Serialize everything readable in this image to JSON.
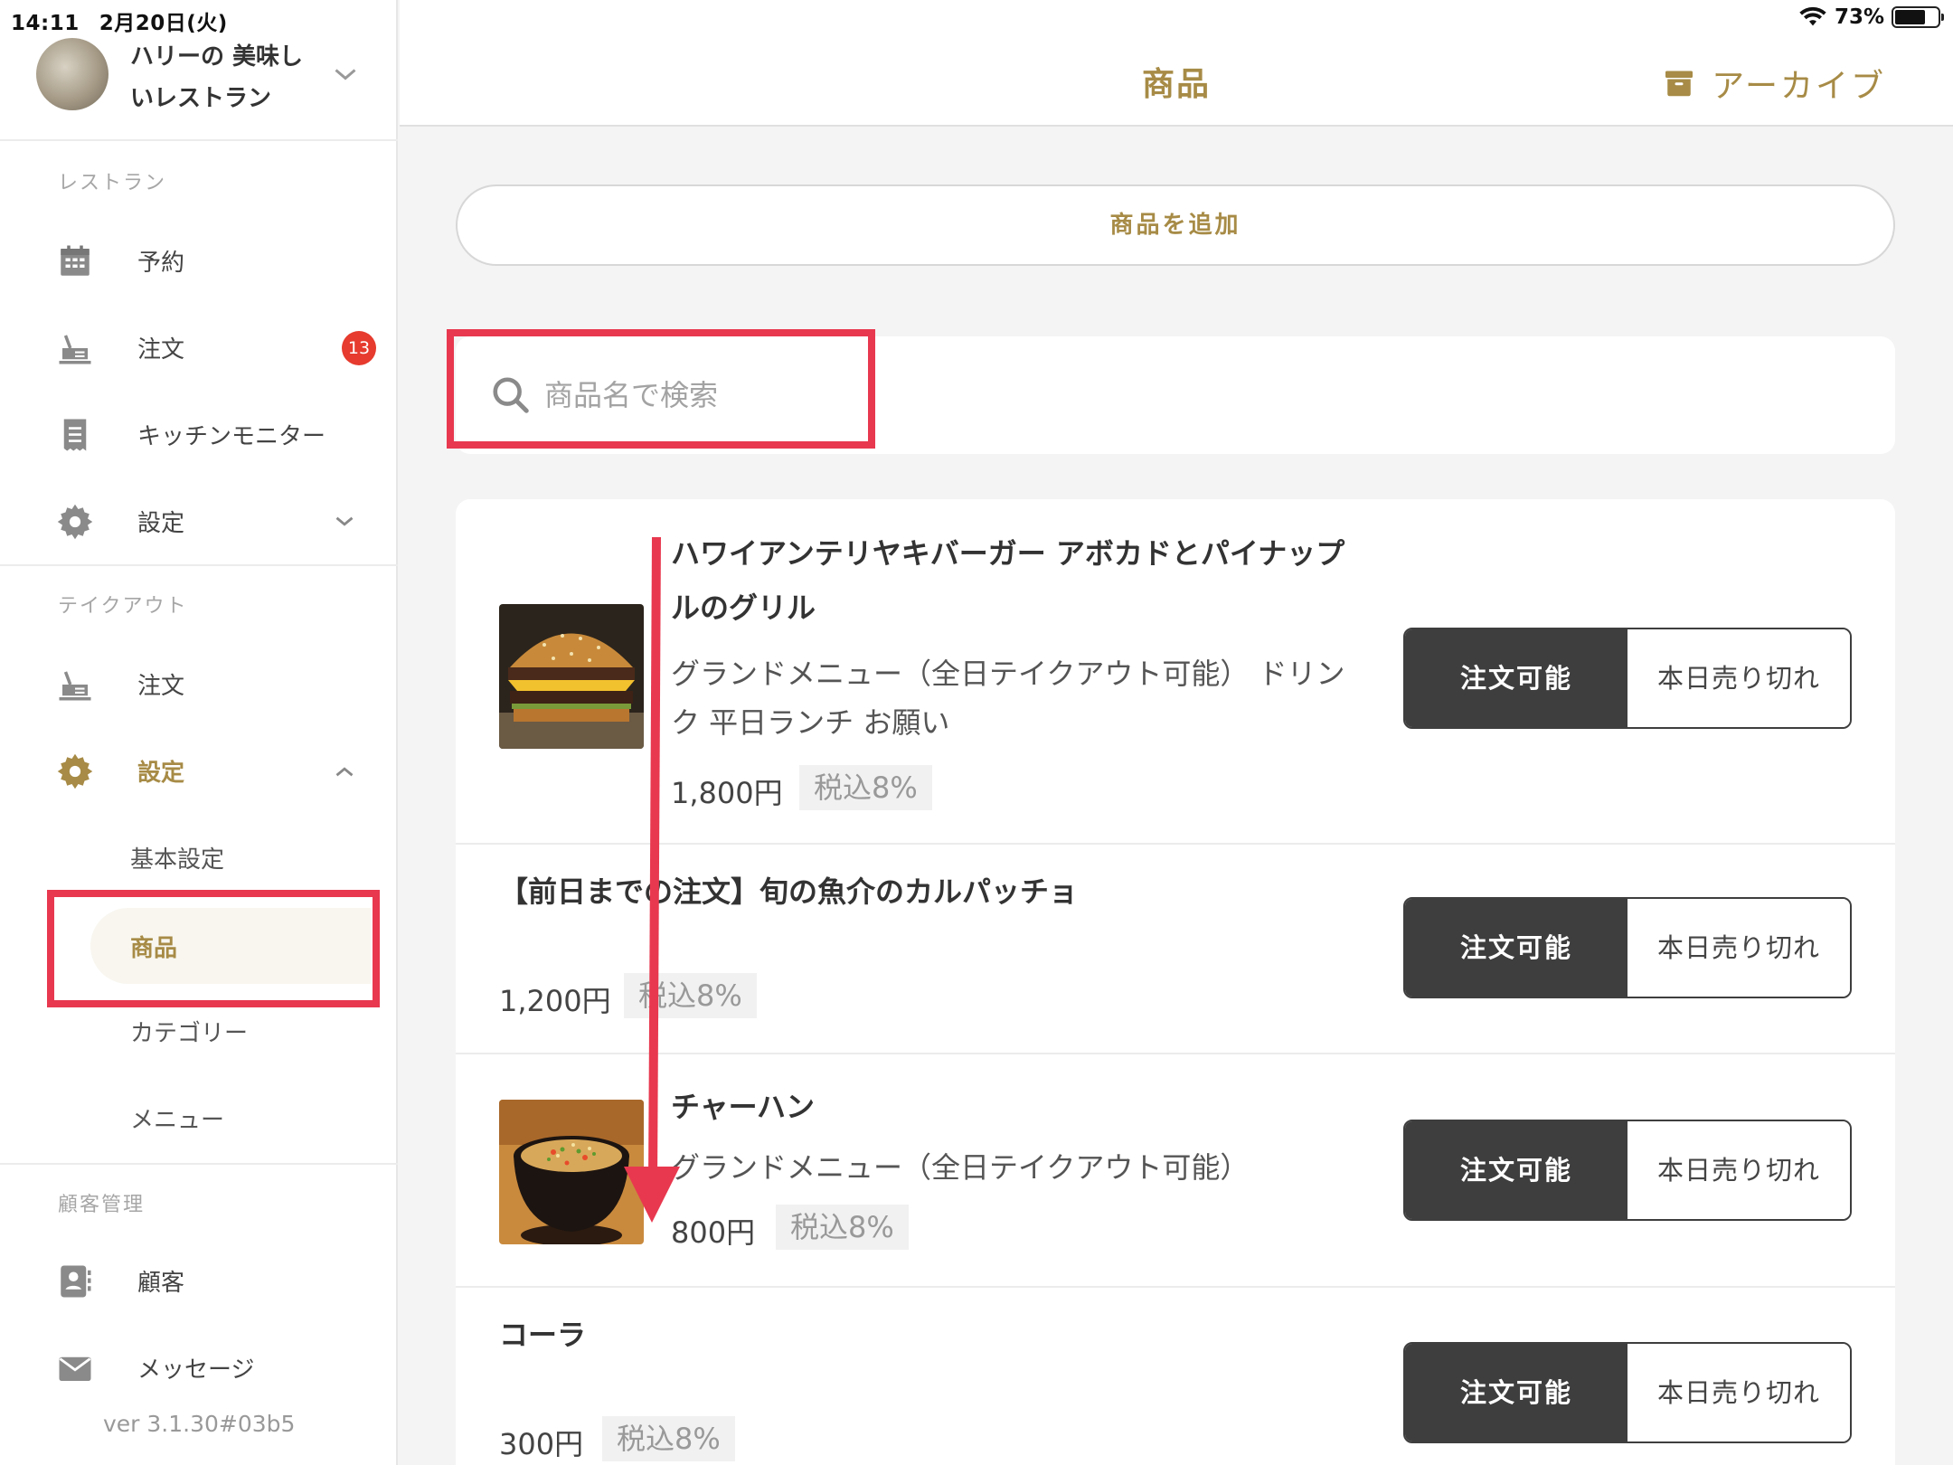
{
  "status_bar": {
    "time": "14:11",
    "date": "2月20日(火)",
    "battery": "73%"
  },
  "account": {
    "name": "ハリーの 美味しいレストラン"
  },
  "sidebar": {
    "restaurant_label": "レストラン",
    "restaurant_items": [
      {
        "label": "予約",
        "icon": "calendar-icon"
      },
      {
        "label": "注文",
        "icon": "order-icon",
        "badge": "13"
      },
      {
        "label": "キッチンモニター",
        "icon": "receipt-icon"
      },
      {
        "label": "設定",
        "icon": "gear-icon"
      }
    ],
    "takeout_label": "テイクアウト",
    "takeout_items": [
      {
        "label": "注文",
        "icon": "order-icon"
      },
      {
        "label": "設定",
        "icon": "gear-icon"
      }
    ],
    "settings_sub": [
      "基本設定",
      "商品",
      "カテゴリー",
      "メニュー"
    ],
    "customer_label": "顧客管理",
    "customer_items": [
      {
        "label": "顧客",
        "icon": "contact-icon"
      },
      {
        "label": "メッセージ",
        "icon": "mail-icon"
      }
    ],
    "version": "ver 3.1.30#03b5"
  },
  "header": {
    "title": "商品",
    "archive_label": "アーカイブ"
  },
  "add_button_label": "商品を追加",
  "search": {
    "placeholder": "商品名で検索"
  },
  "toggle": {
    "available": "注文可能",
    "sold_out": "本日売り切れ"
  },
  "products": [
    {
      "name_lines": [
        "ハワイアンテリヤキバーガー アボカドとパイナップ",
        "ルのグリル"
      ],
      "category_lines": [
        "グランドメニュー（全日テイクアウト可能） ドリン",
        "ク 平日ランチ お願い"
      ],
      "price": "1,800円",
      "tax": "税込8%"
    },
    {
      "name": "【前日までの注文】旬の魚介のカルパッチョ",
      "price": "1,200円",
      "tax": "税込8%"
    },
    {
      "name": "チャーハン",
      "category": "グランドメニュー（全日テイクアウト可能）",
      "price": "800円",
      "tax": "税込8%"
    },
    {
      "name": "コーラ",
      "price": "300円",
      "tax": "税込8%"
    }
  ],
  "colors": {
    "accent": "#a78b46",
    "highlight": "#e8384f",
    "toggle_dark": "#3e3e3e",
    "badge": "#e63b2e"
  }
}
